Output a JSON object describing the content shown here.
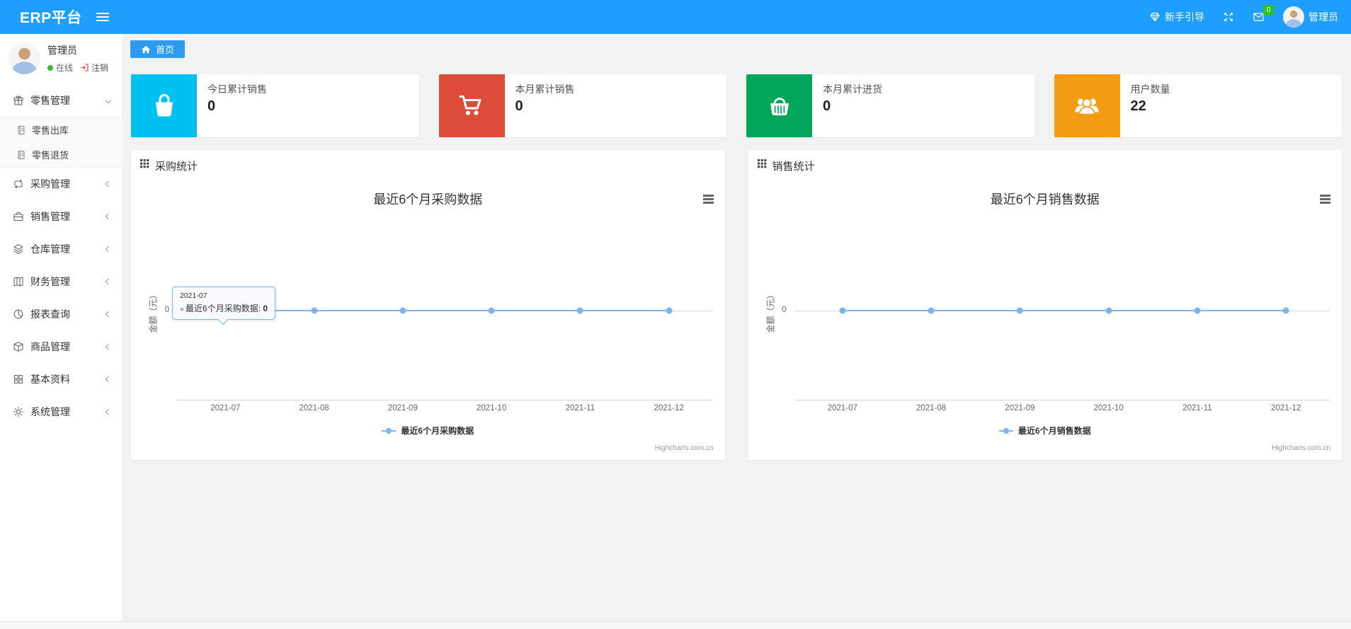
{
  "navbar": {
    "brand": "ERP平台",
    "guide_label": "新手引导",
    "message_badge": "0",
    "user_name": "管理员",
    "icons": [
      "menu-icon",
      "gem-icon",
      "fullscreen-icon",
      "mail-icon",
      "avatar"
    ]
  },
  "sidebar": {
    "user": {
      "name": "管理员",
      "status": "在线",
      "logout_label": "注销"
    },
    "menu": [
      {
        "label": "零售管理",
        "icon": "gift-icon",
        "expanded": true,
        "children": [
          {
            "label": "零售出库",
            "icon": "file-icon"
          },
          {
            "label": "零售退货",
            "icon": "file-icon"
          }
        ]
      },
      {
        "label": "采购管理",
        "icon": "repeat-icon"
      },
      {
        "label": "销售管理",
        "icon": "briefcase-icon"
      },
      {
        "label": "仓库管理",
        "icon": "layers-icon"
      },
      {
        "label": "财务管理",
        "icon": "book-icon"
      },
      {
        "label": "报表查询",
        "icon": "pie-chart-icon"
      },
      {
        "label": "商品管理",
        "icon": "package-icon"
      },
      {
        "label": "基本资料",
        "icon": "grid-icon"
      },
      {
        "label": "系统管理",
        "icon": "gear-icon"
      }
    ]
  },
  "breadcrumb": {
    "home_tab": "首页"
  },
  "stat_cards": [
    {
      "label": "今日累计销售",
      "value": "0",
      "color": "#00c0ef",
      "icon": "shopping-bag-icon"
    },
    {
      "label": "本月累计销售",
      "value": "0",
      "color": "#dd4b39",
      "icon": "shopping-cart-icon"
    },
    {
      "label": "本月累计进货",
      "value": "0",
      "color": "#00a65a",
      "icon": "shopping-basket-icon"
    },
    {
      "label": "用户数量",
      "value": "22",
      "color": "#f39c12",
      "icon": "users-icon"
    }
  ],
  "chart_data": [
    {
      "type": "line",
      "panel_title": "采购统计",
      "title": "最近6个月采购数据",
      "categories": [
        "2021-07",
        "2021-08",
        "2021-09",
        "2021-10",
        "2021-11",
        "2021-12"
      ],
      "series": [
        {
          "name": "最近6个月采购数据",
          "values": [
            0,
            0,
            0,
            0,
            0,
            0
          ]
        }
      ],
      "ylabel": "金额（元）",
      "yticks": [
        "0"
      ],
      "ylim": [
        0,
        1
      ],
      "grid": true,
      "legend_position": "bottom",
      "line_color": "#7cb5ec",
      "credit": "Highcharts.com.cn",
      "tooltip": {
        "category": "2021-07",
        "series_name": "最近6个月采购数据",
        "value": "0"
      }
    },
    {
      "type": "line",
      "panel_title": "销售统计",
      "title": "最近6个月销售数据",
      "categories": [
        "2021-07",
        "2021-08",
        "2021-09",
        "2021-10",
        "2021-11",
        "2021-12"
      ],
      "series": [
        {
          "name": "最近6个月销售数据",
          "values": [
            0,
            0,
            0,
            0,
            0,
            0
          ]
        }
      ],
      "ylabel": "金额（元）",
      "yticks": [
        "0"
      ],
      "ylim": [
        0,
        1
      ],
      "grid": true,
      "legend_position": "bottom",
      "line_color": "#7cb5ec",
      "credit": "Highcharts.com.cn",
      "tooltip": null
    }
  ],
  "colors": {
    "navbar": "#1e9fff",
    "tab": "#2d9cf0",
    "line": "#7cb5ec",
    "badge_green": "#2ec12e",
    "status_green": "#3cb93c",
    "logout_red": "#d9534f"
  }
}
